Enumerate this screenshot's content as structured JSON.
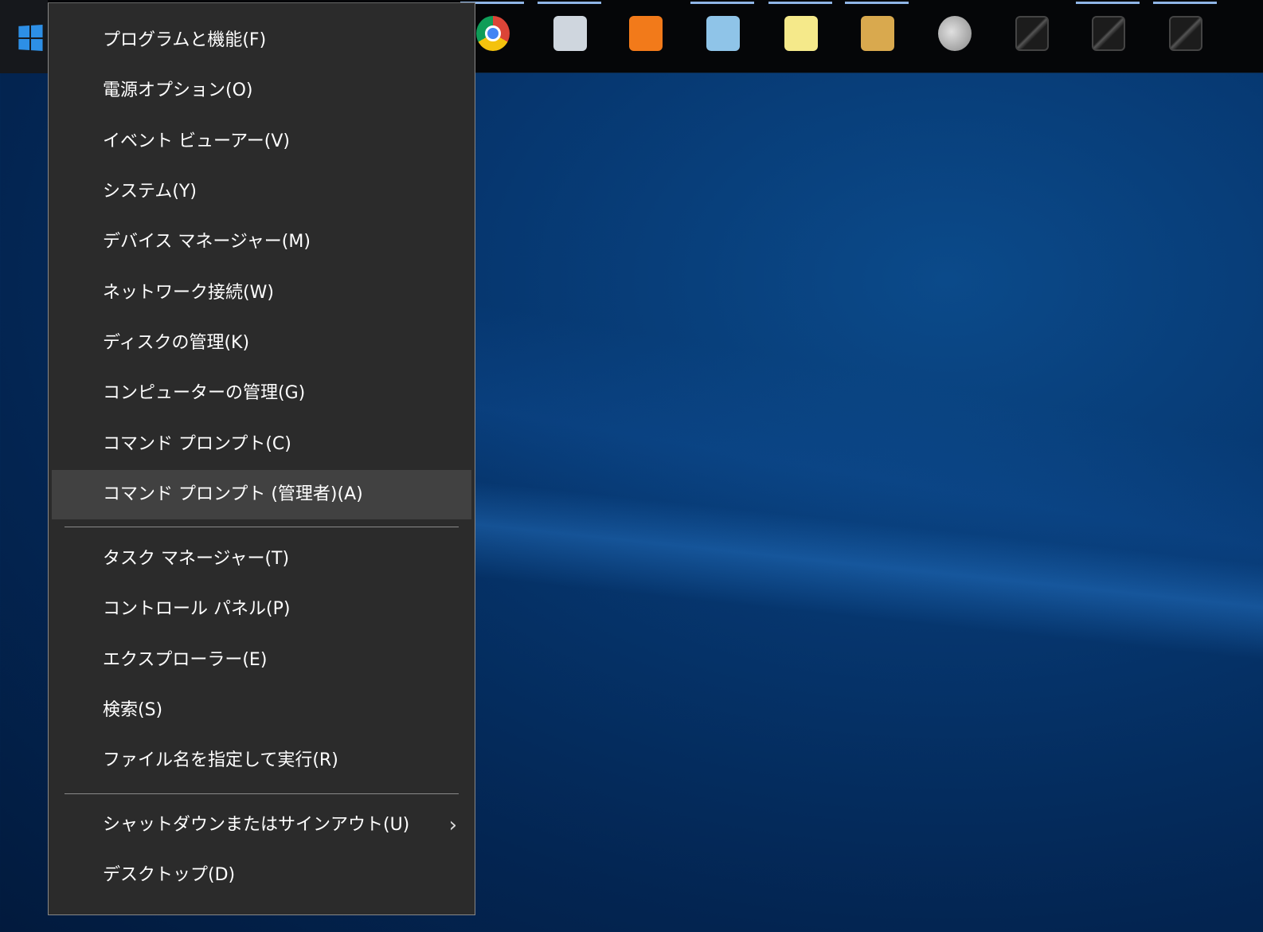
{
  "taskbar": {
    "start_button": "windows-start",
    "icons": [
      {
        "name": "chrome",
        "running": true,
        "color": "#db4437"
      },
      {
        "name": "performance-monitor",
        "running": true,
        "color": "#cfd6de"
      },
      {
        "name": "media-player",
        "running": false,
        "color": "#f27a1a"
      },
      {
        "name": "paint",
        "running": true,
        "color": "#8fc4e8"
      },
      {
        "name": "sticky-notes",
        "running": true,
        "color": "#f5e98a"
      },
      {
        "name": "checklist-app",
        "running": true,
        "color": "#d9a94e"
      },
      {
        "name": "speaker",
        "running": false,
        "color": "#a8a8a8"
      },
      {
        "name": "window-1",
        "running": false,
        "color": "#2a2a2a"
      },
      {
        "name": "window-2",
        "running": true,
        "color": "#2a2a2a"
      },
      {
        "name": "window-3",
        "running": true,
        "color": "#2a2a2a"
      }
    ]
  },
  "menu": {
    "group1": [
      {
        "label": "プログラムと機能(F)"
      },
      {
        "label": "電源オプション(O)"
      },
      {
        "label": "イベント ビューアー(V)"
      },
      {
        "label": "システム(Y)"
      },
      {
        "label": "デバイス マネージャー(M)"
      },
      {
        "label": "ネットワーク接続(W)"
      },
      {
        "label": "ディスクの管理(K)"
      },
      {
        "label": "コンピューターの管理(G)"
      },
      {
        "label": "コマンド プロンプト(C)"
      },
      {
        "label": "コマンド プロンプト (管理者)(A)",
        "highlighted": true
      }
    ],
    "group2": [
      {
        "label": "タスク マネージャー(T)"
      },
      {
        "label": "コントロール パネル(P)"
      },
      {
        "label": "エクスプローラー(E)"
      },
      {
        "label": "検索(S)"
      },
      {
        "label": "ファイル名を指定して実行(R)"
      }
    ],
    "group3": [
      {
        "label": "シャットダウンまたはサインアウト(U)",
        "submenu": true
      },
      {
        "label": "デスクトップ(D)"
      }
    ]
  }
}
